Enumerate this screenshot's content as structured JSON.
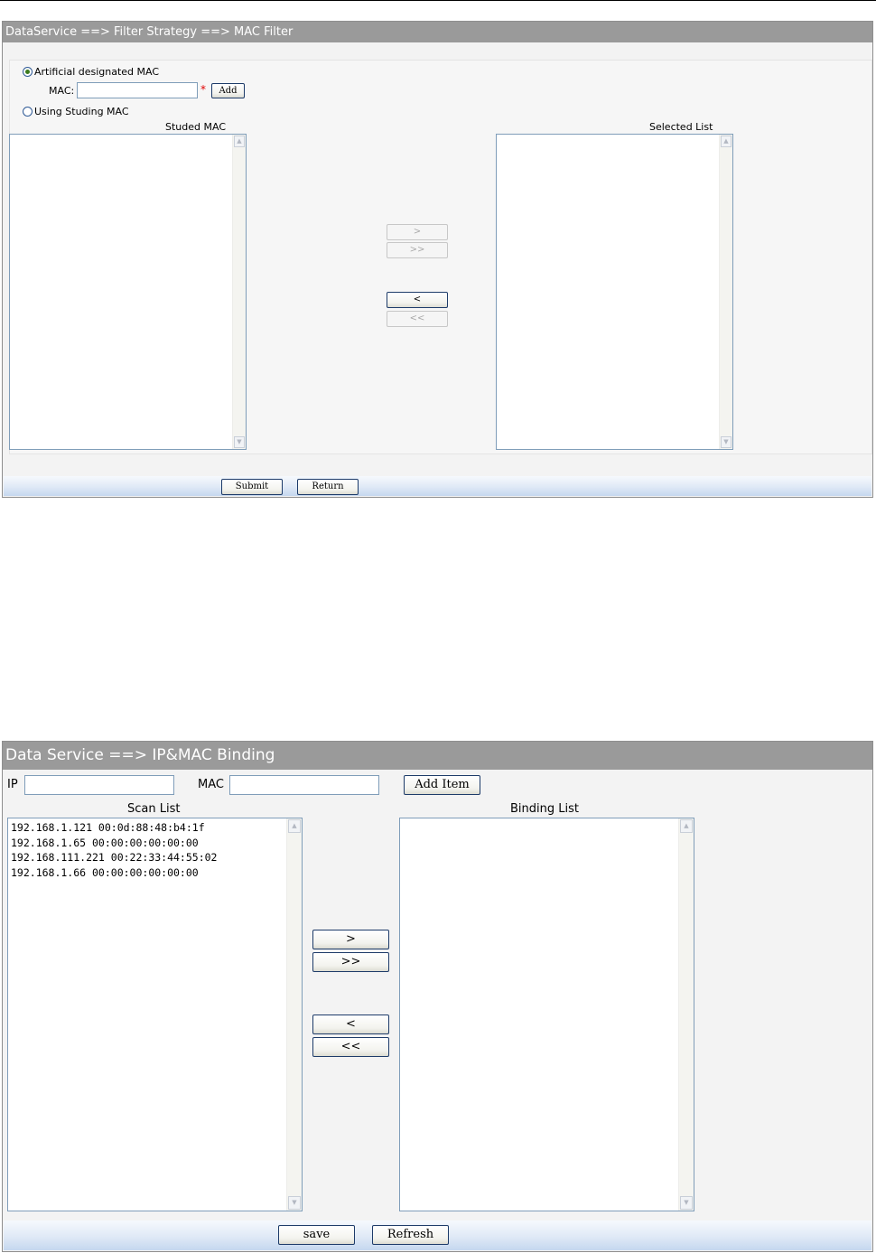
{
  "mac_filter": {
    "title": "DataService ==> Filter Strategy ==> MAC Filter",
    "mode_options": [
      {
        "label": "Artificial designated MAC",
        "selected": true
      },
      {
        "label": "Using Studing MAC",
        "selected": false
      }
    ],
    "mac_label": "MAC:",
    "mac_value": "",
    "required_mark": "*",
    "add_button": "Add",
    "left_list_title": "Studed MAC",
    "right_list_title": "Selected List",
    "left_items": [],
    "right_items": [],
    "move_buttons": {
      "move_right": ">",
      "move_all_right": ">>",
      "move_left": "<",
      "move_all_left": "<<"
    },
    "submit_button": "Submit",
    "return_button": "Return"
  },
  "ip_mac_binding": {
    "title": "Data Service ==> IP&MAC Binding",
    "ip_label": "IP",
    "ip_value": "",
    "mac_label": "MAC",
    "mac_value": "",
    "add_item_button": "Add Item",
    "scan_list_title": "Scan List",
    "binding_list_title": "Binding List",
    "scan_items": [
      "192.168.1.121 00:0d:88:48:b4:1f",
      "192.168.1.65 00:00:00:00:00:00",
      "192.168.111.221 00:22:33:44:55:02",
      "192.168.1.66 00:00:00:00:00:00"
    ],
    "binding_items": [],
    "move_buttons": {
      "move_right": ">",
      "move_all_right": ">>",
      "move_left": "<",
      "move_all_left": "<<"
    },
    "save_button": "save",
    "refresh_button": "Refresh"
  },
  "icons": {
    "scroll_up": "▲",
    "scroll_down": "▼"
  }
}
